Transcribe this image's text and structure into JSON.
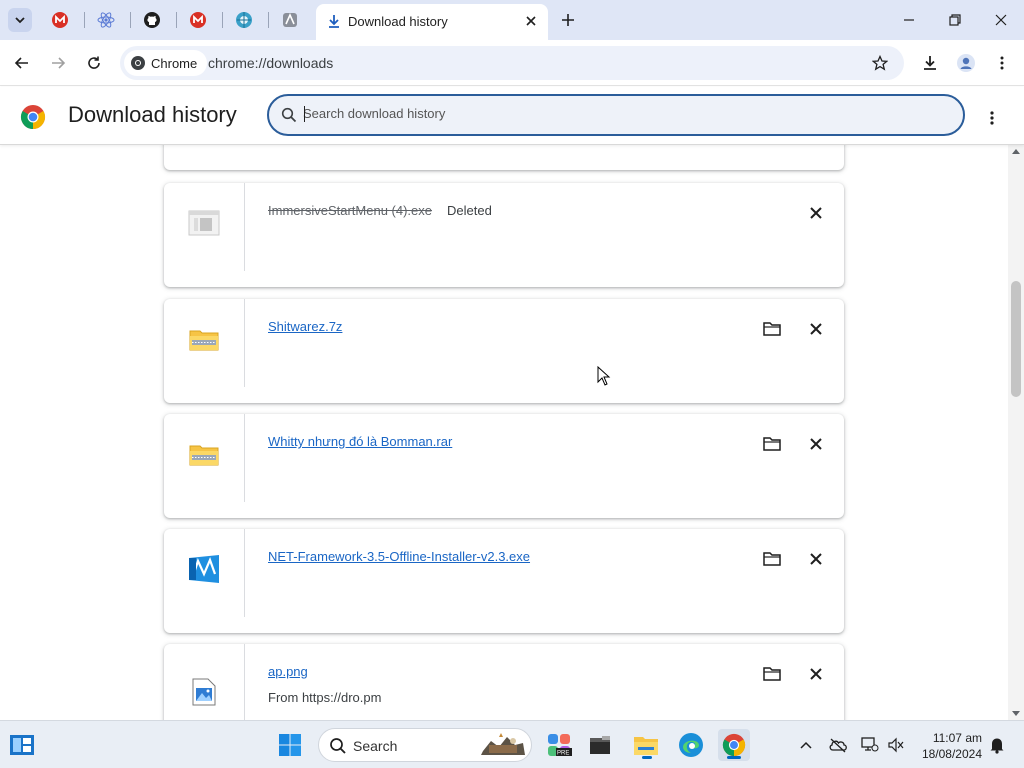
{
  "tab": {
    "title": "Download history",
    "pinned": [
      {
        "name": "gmail-tab",
        "icon": "gmail-icon"
      },
      {
        "name": "react-tab",
        "icon": "react-icon"
      },
      {
        "name": "github-tab",
        "icon": "github-icon"
      },
      {
        "name": "gmail-tab-2",
        "icon": "gmail-icon"
      },
      {
        "name": "web-tab",
        "icon": "globe-icon"
      },
      {
        "name": "app-tab",
        "icon": "app-icon"
      }
    ]
  },
  "toolbar": {
    "chip_label": "Chrome",
    "url": "chrome://downloads"
  },
  "header": {
    "title": "Download history",
    "search_placeholder": "Search download history"
  },
  "downloads": [
    {
      "filename": "ImmersiveStartMenu (4).exe",
      "status": "Deleted",
      "icon": "exe-icon",
      "deleted": true,
      "from": ""
    },
    {
      "filename": "Shitwarez.7z",
      "status": "",
      "icon": "archive-icon",
      "deleted": false,
      "from": ""
    },
    {
      "filename": "Whitty nhưng đó là Bomman.rar",
      "status": "",
      "icon": "archive-icon",
      "deleted": false,
      "from": ""
    },
    {
      "filename": "NET-Framework-3.5-Offline-Installer-v2.3.exe",
      "status": "",
      "icon": "installer-icon",
      "deleted": false,
      "from": ""
    },
    {
      "filename": "ap.png",
      "status": "",
      "icon": "image-icon",
      "deleted": false,
      "from": "From https://dro.pm"
    }
  ],
  "taskbar": {
    "search_label": "Search",
    "time": "11:07 am",
    "date": "18/08/2024"
  },
  "colors": {
    "accent": "#1a66c5",
    "tabstrip": "#dfe6f6",
    "search_border": "#2b5d9a"
  }
}
